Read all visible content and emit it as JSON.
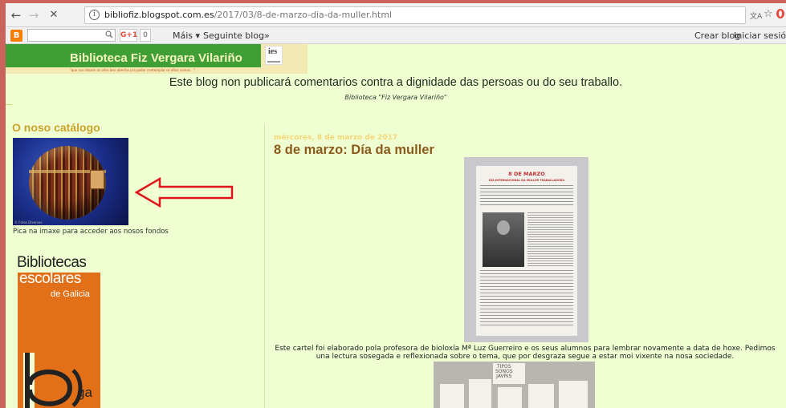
{
  "browser": {
    "url_host": "bibliofiz.blogspot.com.es",
    "url_path": "/2017/03/8-de-marzo-dia-da-muller.html",
    "back_glyph": "←",
    "forward_glyph": "→",
    "stop_glyph": "✕",
    "info_glyph": "i",
    "star_glyph": "☆",
    "menu_glyph": "⋮"
  },
  "navbar": {
    "logo_glyph": "B",
    "search_glyph": "🔍",
    "gplus_label": "G+1",
    "gplus_count": "0",
    "more_label": "Máis ▾",
    "next_blog_label": "Seguinte blog»",
    "create_blog_label": "Crear blog",
    "sign_in_label": "Iniciar sesión"
  },
  "header": {
    "title": "Biblioteca Fiz Vergara Vilariño",
    "motto": "\"que nos deixen os ollos ben abertos pra poder contemplar os altos cumes...\"",
    "ies_logo_text": "ies"
  },
  "notice": {
    "text": "Este blog non publicará comentarios contra a dignidade das persoas ou do seu traballo.",
    "signature": "Biblioteca \"Fiz Vergara Vilariño\""
  },
  "sidebar": {
    "catalog_title": "O noso catálogo",
    "catalog_image_caption": "© Fotos Diversas",
    "catalog_text": "Pica na imaxe para acceder aos nosos fondos",
    "be_line1": "Bibliotecas",
    "be_line2": "escolares",
    "be_line3": "de Galicia",
    "be_ga": "ga"
  },
  "post": {
    "date": "mércores, 8 de marzo de 2017",
    "title": "8 de marzo: Día da muller",
    "poster_heading": "8 DE MARZO",
    "poster_subheading": "DÍA INTERNACIONAL DA MULLER TRABALLADORA",
    "body": "Este cartel foi elaborado pola profesora de bioloxía Mª Luz Guerreiro e os seus alumnos para lembrar novamente a data de hoxe. Pedimos una lectura sosegada e reflexionada sobre o tema, que por desgraza segue a estar moi vixente na nosa sociedade.",
    "photo2_label": "TIPOS\nSONOS\nJAVRIS"
  },
  "colors": {
    "page_bg": "#f0ffd2",
    "banner_green": "#3f9f35",
    "title_brown": "#8a5a1b",
    "catalog_gold": "#c9a32c",
    "arrow_red": "#e0141b",
    "be_orange": "#e27019"
  }
}
